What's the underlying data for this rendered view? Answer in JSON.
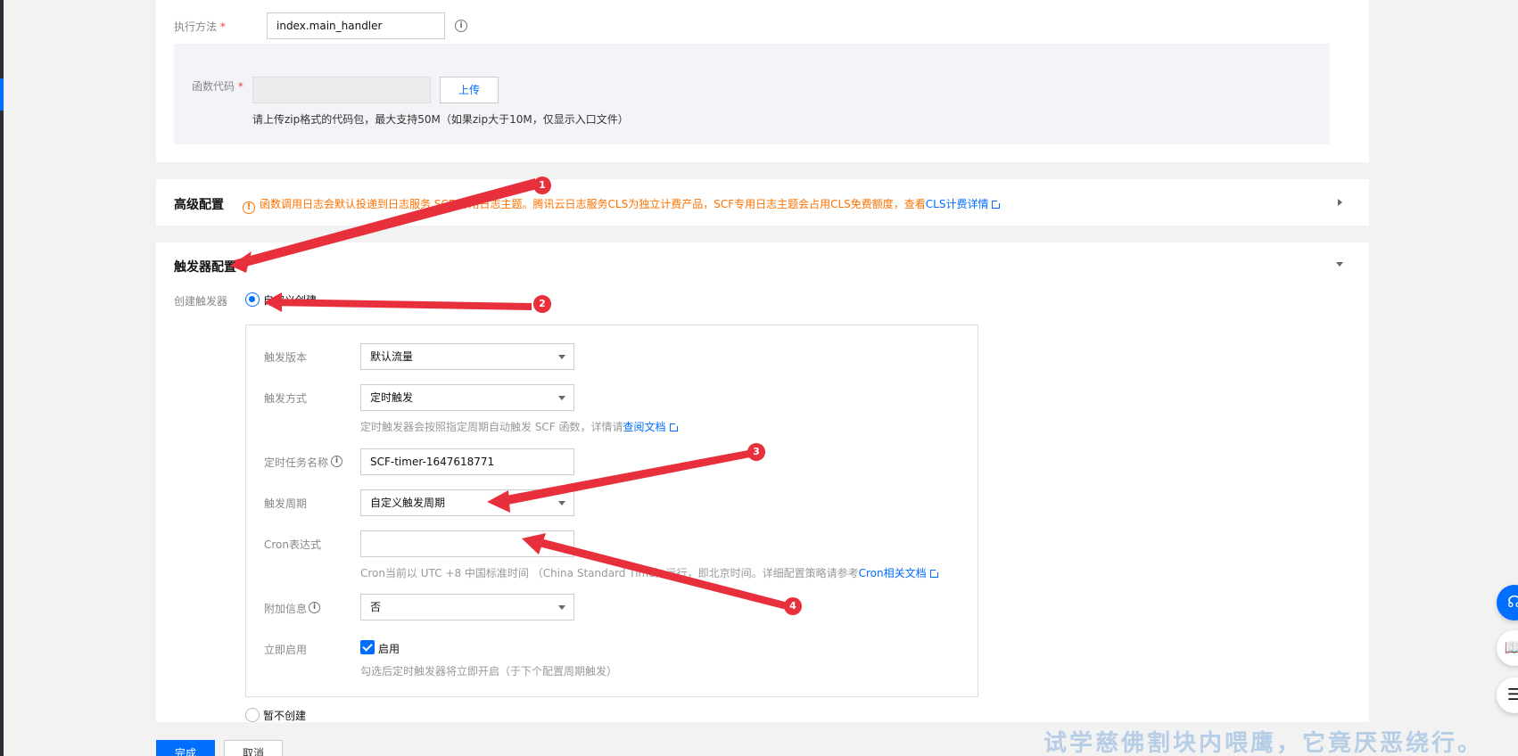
{
  "exec": {
    "label": "执行方法",
    "value": "index.main_handler"
  },
  "code": {
    "label": "函数代码",
    "upload_label": "上传",
    "hint": "请上传zip格式的代码包，最大支持50M（如果zip大于10M，仅显示入口文件）"
  },
  "advanced": {
    "title": "高级配置",
    "warning": "函数调用日志会默认投递到日志服务 SCF 专用日志主题。腾讯云日志服务CLS为独立计费产品，SCF专用日志主题会占用CLS免费额度，查看",
    "warning_link": "CLS计费详情"
  },
  "trigger_section": {
    "title": "触发器配置",
    "create_label": "创建触发器",
    "custom_option": "自定义创建",
    "none_option": "暂不创建"
  },
  "trigger_form": {
    "version": {
      "label": "触发版本",
      "value": "默认流量"
    },
    "method": {
      "label": "触发方式",
      "value": "定时触发",
      "hint": "定时触发器会按照指定周期自动触发 SCF 函数，详情请",
      "hint_link": "查阅文档"
    },
    "task_name": {
      "label": "定时任务名称",
      "value": "SCF-timer-1647618771"
    },
    "period": {
      "label": "触发周期",
      "value": "自定义触发周期"
    },
    "cron": {
      "label": "Cron表达式",
      "value": "",
      "hint": "Cron当前以 UTC +8 中国标准时间 （China Standard Time）运行，即北京时间。详细配置策略请参考",
      "hint_link": "Cron相关文档"
    },
    "extra": {
      "label": "附加信息",
      "value": "否"
    },
    "enable": {
      "label": "立即启用",
      "checkbox_label": "启用",
      "hint": "勾选后定时触发器将立即开启（于下个配置周期触发）"
    }
  },
  "actions": {
    "finish": "完成",
    "cancel": "取消"
  },
  "annotations": [
    "1",
    "2",
    "3",
    "4"
  ],
  "watermark": "试学慈佛割块内喂鹰，它竟厌恶绕行。",
  "colors": {
    "primary": "#006eff",
    "warning": "#ff7200",
    "required": "#e54545",
    "annotation": "#e8303d"
  },
  "icons": [
    "info-icon",
    "warning-icon",
    "external-link-icon",
    "chevron-right-icon",
    "chevron-down-icon",
    "headset-icon",
    "book-icon",
    "list-icon"
  ]
}
